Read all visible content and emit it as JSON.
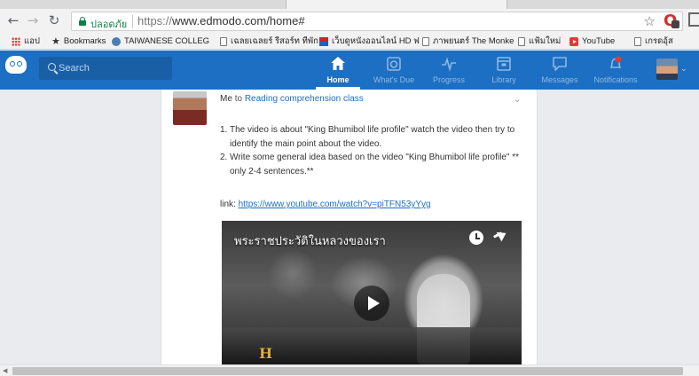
{
  "browser": {
    "secure_label": "ปลอดภัย",
    "url_scheme": "https://",
    "url_rest": "www.edmodo.com/home#",
    "bookmarks": [
      {
        "label": "แอป",
        "icon": "apps-icon"
      },
      {
        "label": "Bookmarks",
        "icon": "star-icon"
      },
      {
        "label": "TAIWANESE COLLEG",
        "icon": "globe-icon"
      },
      {
        "label": "เฉลยเฉลยร์ รีสอร์ท ทีพัก",
        "icon": "page-icon"
      },
      {
        "label": "เว็บดูหนังออนไลน์ HD ฟ",
        "icon": "flag-icon"
      },
      {
        "label": "ภาพยนตร์ The Monke",
        "icon": "page-icon"
      },
      {
        "label": "แฟ้มใหม่",
        "icon": "page-icon"
      },
      {
        "label": "YouTube",
        "icon": "youtube-icon"
      },
      {
        "label": "เกรดอุ้ส",
        "icon": "page-icon"
      }
    ]
  },
  "edmodo": {
    "search_placeholder": "Search",
    "nav": [
      {
        "label": "Home",
        "icon": "home-icon",
        "active": true
      },
      {
        "label": "What's Due",
        "icon": "camera-icon",
        "active": false
      },
      {
        "label": "Progress",
        "icon": "pulse-icon",
        "active": false
      },
      {
        "label": "Library",
        "icon": "library-icon",
        "active": false
      },
      {
        "label": "Messages",
        "icon": "message-icon",
        "active": false
      },
      {
        "label": "Notifications",
        "icon": "bell-icon",
        "active": false
      }
    ]
  },
  "post": {
    "sender": "Me",
    "to_word": "to",
    "class_name": "Reading comprehension class",
    "items": [
      {
        "num": "1.",
        "text": "The video is about \"King Bhumibol life profile\" watch the video then try to identify the main point about the video."
      },
      {
        "num": "2.",
        "text": "Write some general idea based on the video \"King Bhumibol life profile\" ** only 2-4 sentences.**"
      }
    ],
    "link_label": "link:",
    "link_url": "https://www.youtube.com/watch?v=piTFN53yYyg",
    "video_title": "พระราชประวัติในหลวงของเรา",
    "channel_logo": "H"
  },
  "colors": {
    "edmodo_blue": "#1c6fc2",
    "link_blue": "#1c6fc2",
    "secure_green": "#0b8043"
  }
}
